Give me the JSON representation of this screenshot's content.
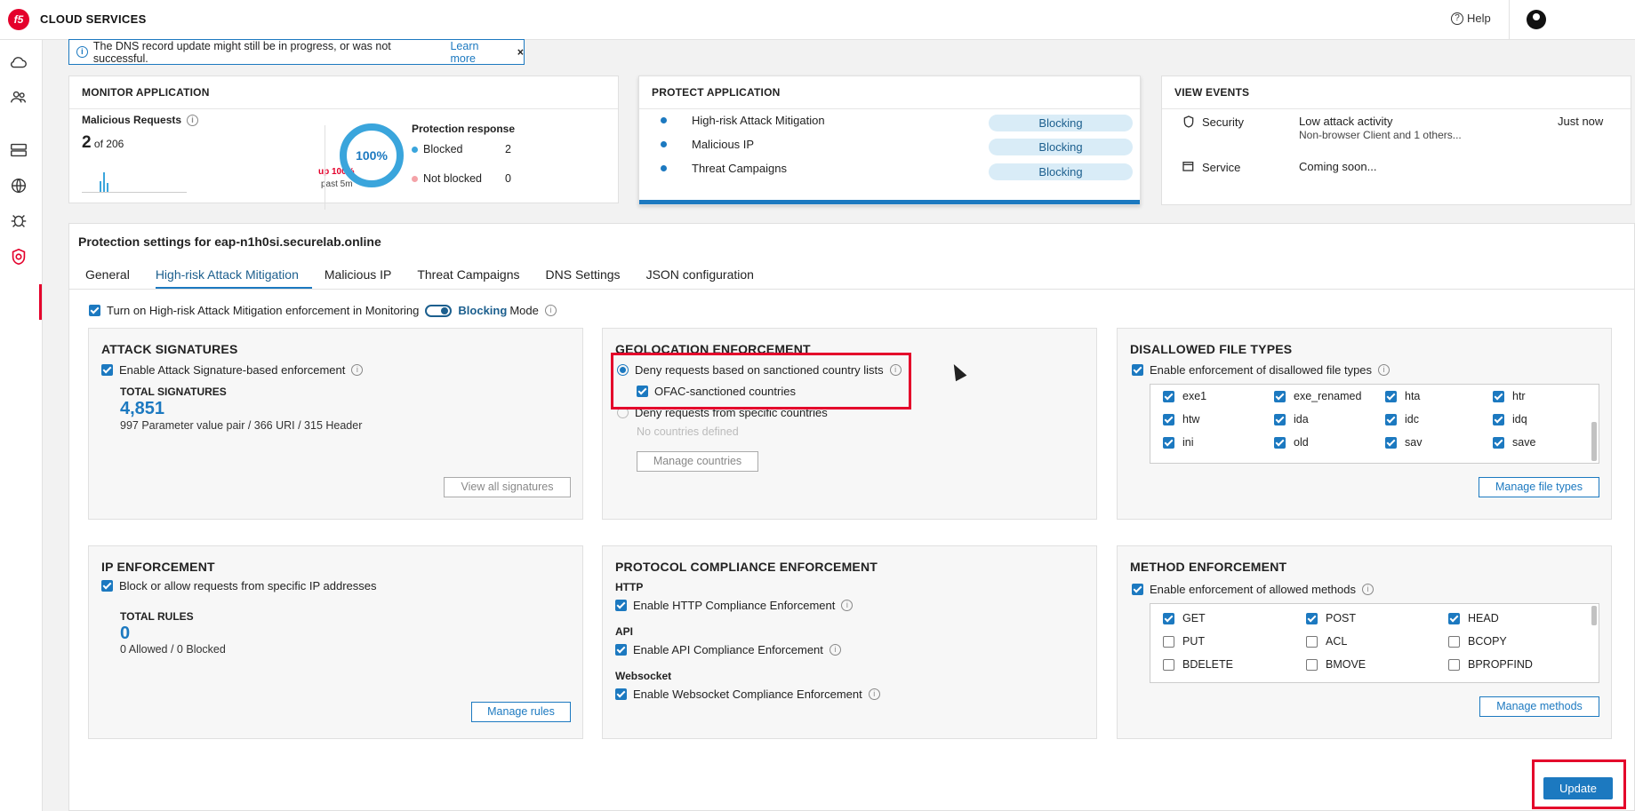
{
  "app": {
    "brand": "CLOUD SERVICES",
    "logo": "f5",
    "help_label": "Help"
  },
  "banner": {
    "text": "The DNS record update might still be in progress, or was not successful.",
    "link": "Learn more",
    "close": "×"
  },
  "monitor": {
    "title": "MONITOR APPLICATION",
    "malicious_label": "Malicious Requests",
    "count": "2",
    "of_total": "of 206",
    "up": "up 100%",
    "past": "past 5m",
    "donut_value": "100%",
    "protection_title": "Protection response",
    "blocked_label": "Blocked",
    "blocked_value": "2",
    "not_blocked_label": "Not blocked",
    "not_blocked_value": "0"
  },
  "protect": {
    "title": "PROTECT APPLICATION",
    "items": [
      {
        "label": "High-risk Attack Mitigation",
        "status": "Blocking"
      },
      {
        "label": "Malicious IP",
        "status": "Blocking"
      },
      {
        "label": "Threat Campaigns",
        "status": "Blocking"
      }
    ]
  },
  "events": {
    "title": "VIEW EVENTS",
    "security_label": "Security",
    "security_status": "Low attack activity",
    "security_detail": "Non-browser Client and 1 others...",
    "security_time": "Just now",
    "service_label": "Service",
    "service_status": "Coming soon..."
  },
  "settings": {
    "title": "Protection settings for eap-n1h0si.securelab.online",
    "tabs": [
      "General",
      "High-risk Attack Mitigation",
      "Malicious IP",
      "Threat Campaigns",
      "DNS Settings",
      "JSON configuration"
    ],
    "active_tab": "High-risk Attack Mitigation",
    "mode_text": "Turn on High-risk Attack Mitigation enforcement in Monitoring",
    "mode_blocking": "Blocking",
    "mode_suffix": "Mode"
  },
  "attack_signatures": {
    "title": "ATTACK SIGNATURES",
    "enable": "Enable Attack Signature-based enforcement",
    "total_label": "TOTAL SIGNATURES",
    "total": "4,851",
    "breakdown": "997 Parameter value pair / 366 URI / 315 Header",
    "button": "View all signatures"
  },
  "geolocation": {
    "title": "GEOLOCATION ENFORCEMENT",
    "option1": "Deny requests based on sanctioned country lists",
    "ofac": "OFAC-sanctioned countries",
    "option2": "Deny requests from specific countries",
    "none": "No countries defined",
    "button": "Manage countries"
  },
  "file_types": {
    "title": "DISALLOWED FILE TYPES",
    "enable": "Enable enforcement of disallowed file types",
    "items": [
      "exe1",
      "exe_renamed",
      "hta",
      "htr",
      "htw",
      "ida",
      "idc",
      "idq",
      "ini",
      "old",
      "sav",
      "save"
    ],
    "button": "Manage file types"
  },
  "ip_enforcement": {
    "title": "IP ENFORCEMENT",
    "enable": "Block or allow requests from specific IP addresses",
    "total_label": "TOTAL RULES",
    "total": "0",
    "breakdown": "0 Allowed / 0 Blocked",
    "button": "Manage rules"
  },
  "protocol": {
    "title": "PROTOCOL COMPLIANCE ENFORCEMENT",
    "http_label": "HTTP",
    "http": "Enable HTTP Compliance Enforcement",
    "api_label": "API",
    "api": "Enable API Compliance Enforcement",
    "ws_label": "Websocket",
    "ws": "Enable Websocket Compliance Enforcement"
  },
  "methods": {
    "title": "METHOD ENFORCEMENT",
    "enable": "Enable enforcement of allowed methods",
    "items": [
      {
        "label": "GET",
        "checked": true
      },
      {
        "label": "POST",
        "checked": true
      },
      {
        "label": "HEAD",
        "checked": true
      },
      {
        "label": "PUT",
        "checked": false
      },
      {
        "label": "ACL",
        "checked": false
      },
      {
        "label": "BCOPY",
        "checked": false
      },
      {
        "label": "BDELETE",
        "checked": false
      },
      {
        "label": "BMOVE",
        "checked": false
      },
      {
        "label": "BPROPFIND",
        "checked": false
      }
    ],
    "button": "Manage methods"
  },
  "update_label": "Update",
  "colors": {
    "accent": "#1c79c0",
    "brand": "#e4002b"
  }
}
